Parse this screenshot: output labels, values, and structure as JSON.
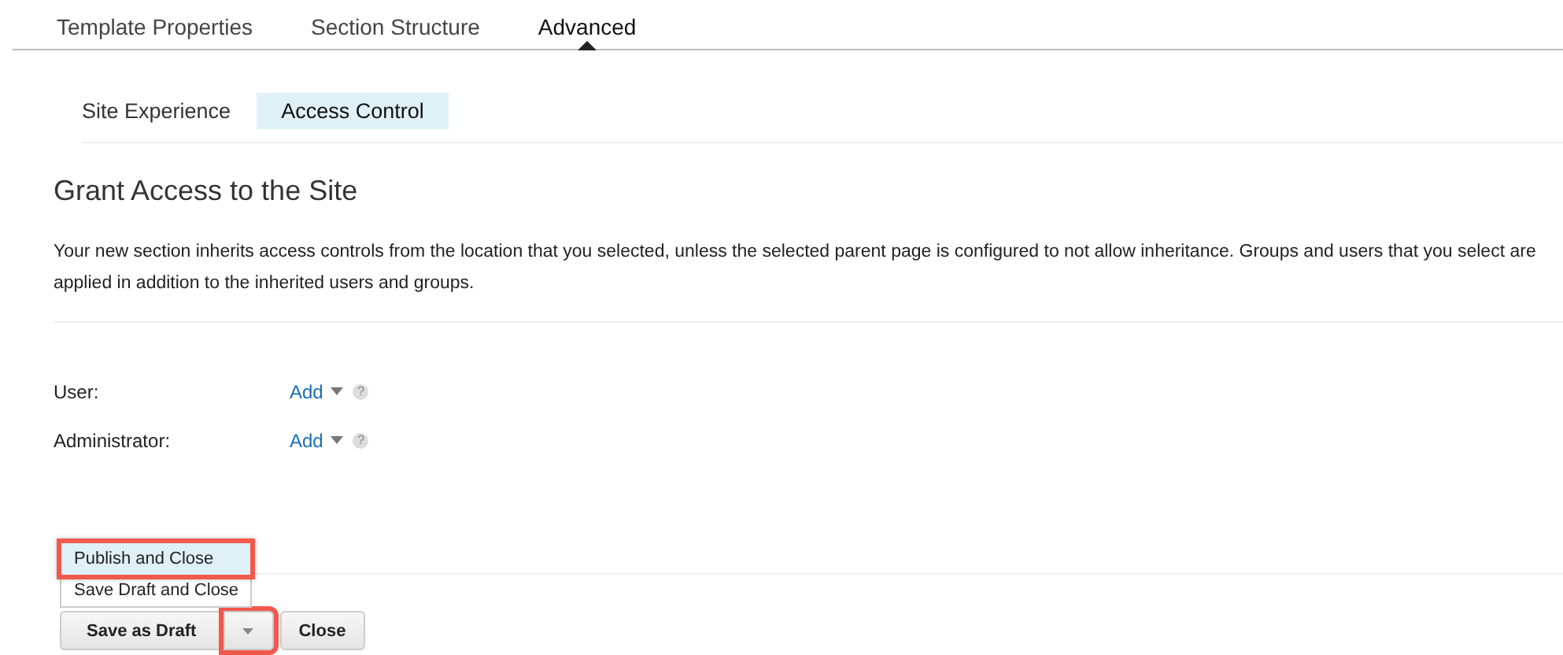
{
  "tabs": [
    {
      "label": "Template Properties",
      "selected": false
    },
    {
      "label": "Section Structure",
      "selected": false
    },
    {
      "label": "Advanced",
      "selected": true
    }
  ],
  "subtabs": [
    {
      "label": "Site Experience",
      "selected": false
    },
    {
      "label": "Access Control",
      "selected": true
    }
  ],
  "heading": "Grant Access to the Site",
  "description": "Your new section inherits access controls from the location that you selected, unless the selected parent page is configured to not allow inheritance. Groups and users that you select are applied in addition to the inherited users and groups.",
  "fields": [
    {
      "label": "User:",
      "action": "Add",
      "help": "?"
    },
    {
      "label": "Administrator:",
      "action": "Add",
      "help": "?"
    }
  ],
  "save_menu": [
    {
      "label": "Publish and Close",
      "selected": true,
      "highlighted": true
    },
    {
      "label": "Save Draft and Close",
      "selected": false,
      "highlighted": false
    }
  ],
  "buttons": {
    "save": "Save as Draft",
    "close": "Close",
    "caret_highlighted": true
  }
}
